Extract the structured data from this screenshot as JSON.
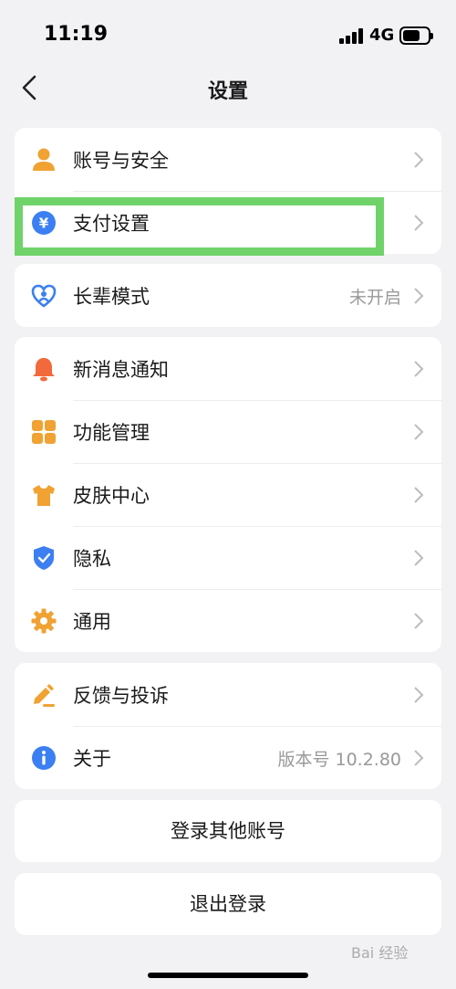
{
  "status_bar": {
    "time": "11:19",
    "network": "4G",
    "battery_level": 0.7
  },
  "nav": {
    "title": "设置",
    "back_icon": "chevron-left-icon"
  },
  "groups": [
    {
      "items": [
        {
          "label": "账号与安全",
          "value": "",
          "icon": "user-icon",
          "icon_color": "#f0a232"
        },
        {
          "label": "支付设置",
          "value": "",
          "icon": "yuan-icon",
          "icon_color": "#3c7ff2"
        }
      ]
    },
    {
      "items": [
        {
          "label": "长辈模式",
          "value": "未开启",
          "icon": "heart-person-icon",
          "icon_color": "#3c7ff2"
        }
      ]
    },
    {
      "items": [
        {
          "label": "新消息通知",
          "value": "",
          "icon": "bell-icon",
          "icon_color": "#f26a3c"
        },
        {
          "label": "功能管理",
          "value": "",
          "icon": "grid-icon",
          "icon_color": "#f0a232"
        },
        {
          "label": "皮肤中心",
          "value": "",
          "icon": "tshirt-icon",
          "icon_color": "#f0a232"
        },
        {
          "label": "隐私",
          "value": "",
          "icon": "shield-icon",
          "icon_color": "#3c7ff2"
        },
        {
          "label": "通用",
          "value": "",
          "icon": "gear-icon",
          "icon_color": "#f0a232"
        }
      ]
    },
    {
      "items": [
        {
          "label": "反馈与投诉",
          "value": "",
          "icon": "pencil-icon",
          "icon_color": "#f0a232"
        },
        {
          "label": "关于",
          "value": "版本号 10.2.80",
          "icon": "info-icon",
          "icon_color": "#3c7ff2"
        }
      ]
    }
  ],
  "actions": {
    "switch_account": "登录其他账号",
    "logout": "退出登录"
  },
  "watermark": "Bai 经验"
}
